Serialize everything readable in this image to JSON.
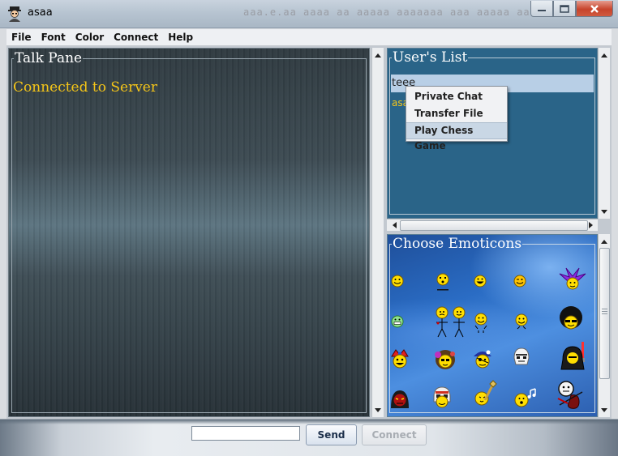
{
  "window": {
    "title": "asaa",
    "ghost_text": "aaa.e.aa aaaa aa aaaaa aaaaaaa aaa aaaaa aaaaa",
    "icon": "user-avatar-icon",
    "buttons": [
      "minimize-icon",
      "maximize-icon",
      "close-icon"
    ]
  },
  "menu": {
    "items": [
      "File",
      "Font",
      "Color",
      "Connect",
      "Help"
    ]
  },
  "talk_pane": {
    "legend": "Talk Pane",
    "message": "Connected to Server"
  },
  "users_pane": {
    "legend": "User's List",
    "users": [
      {
        "name": "teee",
        "selected": true
      },
      {
        "name": "asaa",
        "selected": false
      }
    ]
  },
  "context_menu": {
    "items": [
      "Private Chat",
      "Transfer File",
      "Play Chess Game"
    ],
    "highlighted": "Play Chess Game"
  },
  "emoticons_pane": {
    "legend": "Choose Emoticons",
    "emoticons": [
      "smile",
      "whistle",
      "grin",
      "wink",
      "jester-hat",
      "teeth-grin",
      "couple-stick",
      "cheer",
      "happy-bounce",
      "afro-sunglasses",
      "jester",
      "hippie",
      "pirate",
      "stormtrooper",
      "vader",
      "sith",
      "rebel-pilot",
      "guitar",
      "music-note",
      "violin"
    ]
  },
  "bottom": {
    "input_value": "",
    "send_label": "Send",
    "connect_label": "Connect"
  },
  "colors": {
    "accent_text": "#f5c518",
    "users_bg": "#2a6488",
    "selection": "#b8cfe6"
  }
}
